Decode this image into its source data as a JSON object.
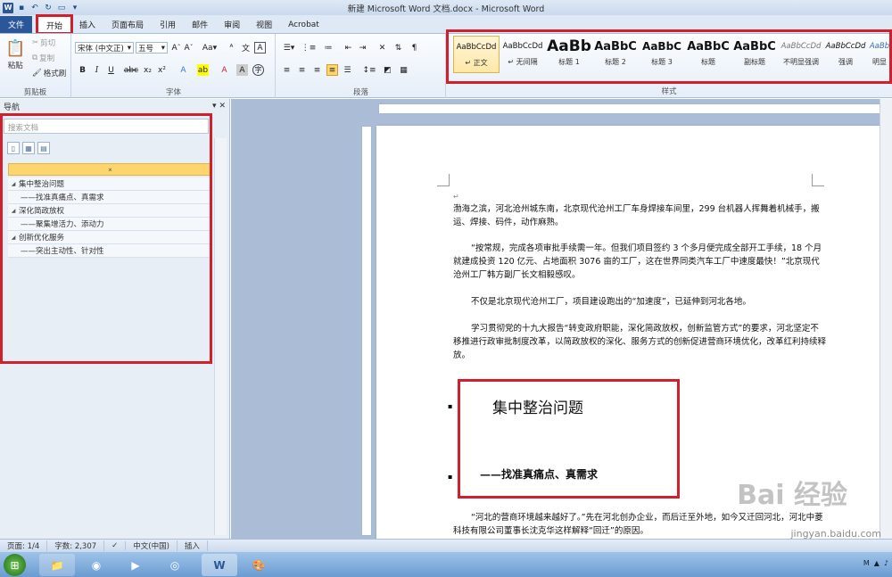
{
  "window": {
    "title": "新建 Microsoft Word 文档.docx - Microsoft Word"
  },
  "tabs": [
    "文件",
    "开始",
    "插入",
    "页面布局",
    "引用",
    "邮件",
    "审阅",
    "视图",
    "Acrobat"
  ],
  "ribbon": {
    "clipboard": {
      "paste": "粘贴",
      "cut": "剪切",
      "copy": "复制",
      "format_painter": "格式刷",
      "label": "剪贴板"
    },
    "font": {
      "name": "宋体 (中文正)",
      "size": "五号",
      "label": "字体"
    },
    "paragraph": {
      "label": "段落"
    },
    "styles": {
      "label": "样式",
      "items": [
        {
          "sample": "AaBbCcDd",
          "name": "↵ 正文"
        },
        {
          "sample": "AaBbCcDd",
          "name": "↵ 无间隔"
        },
        {
          "sample": "AaBb",
          "name": "标题 1"
        },
        {
          "sample": "AaBbC",
          "name": "标题 2"
        },
        {
          "sample": "AaBbC",
          "name": "标题 3"
        },
        {
          "sample": "AaBbC",
          "name": "标题"
        },
        {
          "sample": "AaBbC",
          "name": "副标题"
        },
        {
          "sample": "AaBbCcDd",
          "name": "不明显强调"
        },
        {
          "sample": "AaBbCcDd",
          "name": "强调"
        },
        {
          "sample": "AaBb",
          "name": "明显"
        }
      ]
    }
  },
  "nav": {
    "title": "导航",
    "search_placeholder": "搜索文档",
    "collapse": "⌅",
    "items": [
      {
        "text": "集中整治问题",
        "level": 1
      },
      {
        "text": "——找准真痛点、真需求",
        "level": 2
      },
      {
        "text": "深化简政放权",
        "level": 1
      },
      {
        "text": "——聚集增活力、添动力",
        "level": 2
      },
      {
        "text": "创新优化服务",
        "level": 1
      },
      {
        "text": "——突出主动性、针对性",
        "level": 2
      }
    ]
  },
  "document": {
    "p1": "渤海之滨，河北沧州城东南，北京现代沧州工厂车身焊接车间里，299 台机器人挥舞着机械手，搬运、焊接、码件，动作麻熟。",
    "p2": "“按常规，完成各项审批手续需一年。但我们项目签约 3 个多月便完成全部开工手续，18 个月就建成投资 120 亿元、占地面积 3076 亩的工厂，这在世界同类汽车工厂中速度最快！”北京现代沧州工厂韩方副厂长文相毅感叹。",
    "p3": "不仅是北京现代沧州工厂，项目建设跑出的“加速度”，已延伸到河北各地。",
    "p4": "学习贯彻党的十九大报告“转变政府职能，深化简政放权，创新监管方式”的要求，河北坚定不移推进行政审批制度改革，以简政放权的深化、服务方式的创新促进营商环境优化，改革红利持续释放。",
    "h1": "集中整治问题",
    "h2": "——找准真痛点、真需求",
    "p5": "“河北的营商环境越来越好了。”先在河北创办企业，而后迁至外地，如今又迁回河北，河北中菱科技有限公司董事长沈克华这样解释“回迁”的原因。"
  },
  "status": {
    "page": "页面: 1/4",
    "words": "字数: 2,307",
    "lang": "中文(中国)",
    "mode": "插入"
  },
  "watermark": {
    "site": "jingyan.baidu.com",
    "logo": "Bai 经验"
  }
}
